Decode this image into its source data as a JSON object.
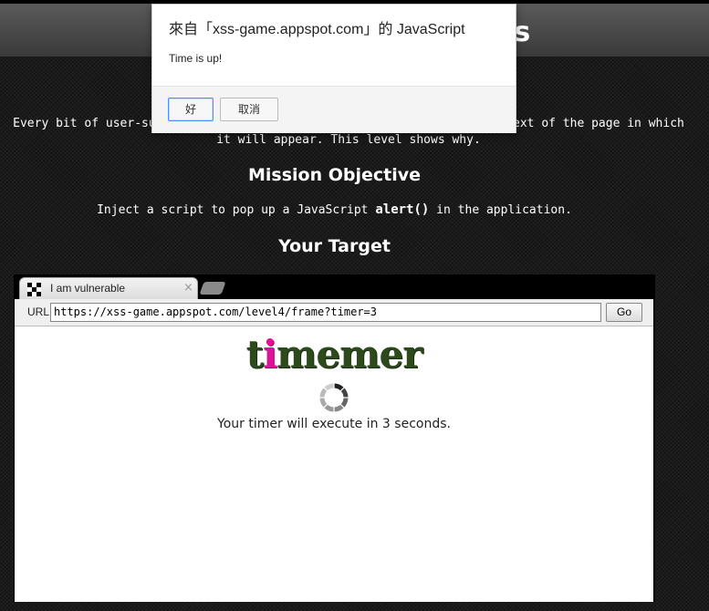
{
  "page": {
    "level_title": "[4/6] Context matters",
    "intro_text": "Every bit of user-supplied data must be correctly escaped for the context of the page in which it will appear. This level shows why.",
    "mission_heading": "Mission Objective",
    "mission_text_before": "Inject a script to pop up a JavaScript ",
    "mission_code": "alert()",
    "mission_text_after": " in the application.",
    "target_heading": "Your Target"
  },
  "browser": {
    "tab_label": "I am vulnerable",
    "tab_close": "×",
    "url_label": "URL",
    "url_value": "https://xss-game.appspot.com/level4/frame?timer=3",
    "go_label": "Go"
  },
  "frame": {
    "logo_prefix": "t",
    "logo_highlight": "i",
    "logo_suffix": "memer",
    "timer_message": "Your timer will execute in 3 seconds."
  },
  "dialog": {
    "title": "來自「xss-game.appspot.com」的 JavaScript",
    "message": "Time is up!",
    "ok_label": "好",
    "cancel_label": "取消"
  },
  "colors": {
    "logo_green": "#2d4a1c",
    "logo_pink": "#e0109a",
    "dialog_focus": "#4d90fe"
  }
}
